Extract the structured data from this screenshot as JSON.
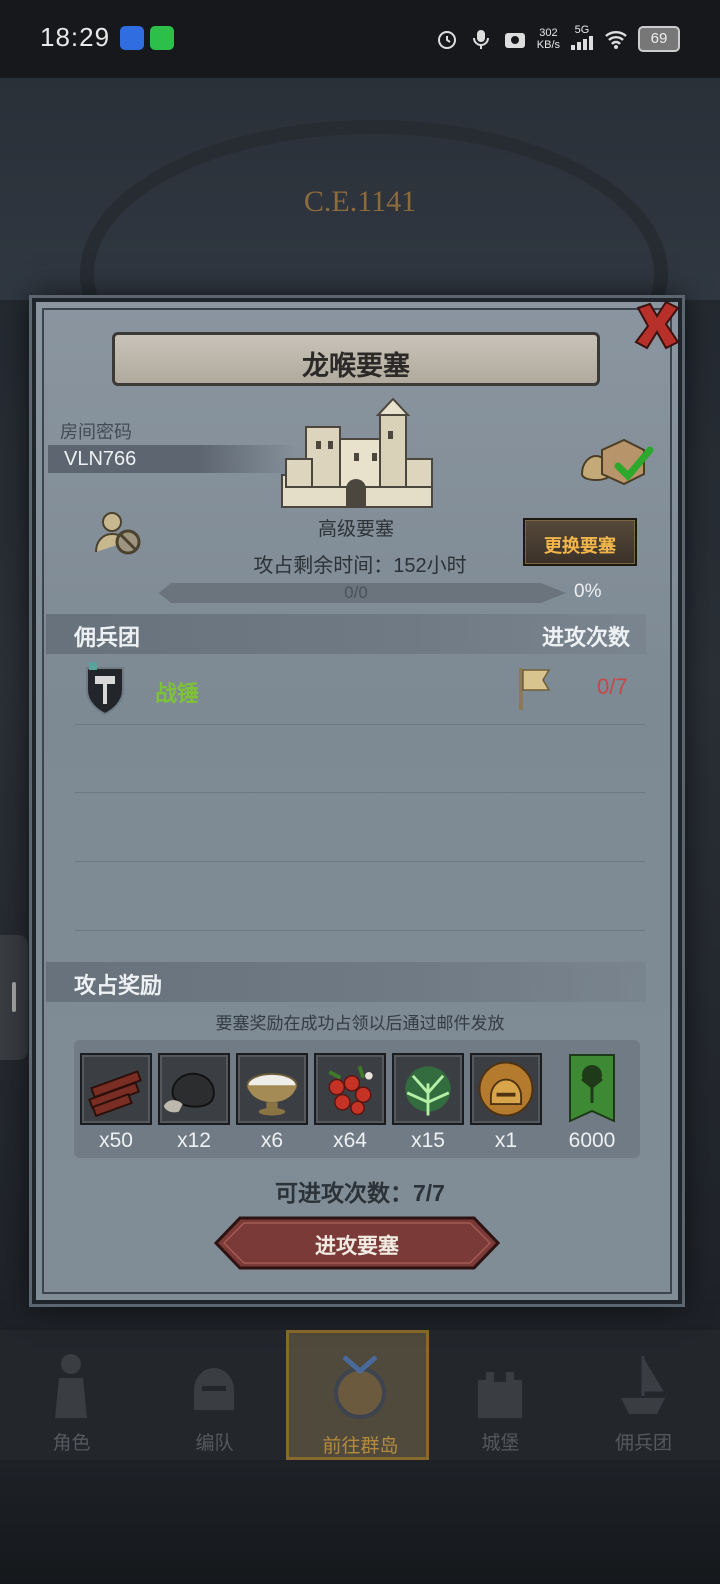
{
  "status_bar": {
    "time": "18:29",
    "net_speed": "302",
    "net_unit": "KB/s",
    "network": "5G",
    "battery": "69",
    "icons": [
      "app-icon-blue",
      "wechat-icon",
      "alarm-icon",
      "mic-icon",
      "camera-icon",
      "signal-icon",
      "wifi-icon"
    ]
  },
  "background": {
    "era": "C.E.1141"
  },
  "dialog": {
    "title": "龙喉要塞",
    "room_label": "房间密码",
    "room_code": "VLN766",
    "fortress_type": "高级要塞",
    "change_button": "更换要塞",
    "time_left": "攻占剩余时间：152小时",
    "progress": {
      "text": "0/0",
      "percent_label": "0%",
      "value": 0
    },
    "mercenary": {
      "header": "佣兵团",
      "attack_header": "进攻次数",
      "rows": [
        {
          "name": "战锤",
          "attacks": "0/7"
        }
      ]
    },
    "rewards": {
      "header": "攻占奖励",
      "note": "要塞奖励在成功占领以后通过邮件发放",
      "items": [
        {
          "icon": "wood-logs-icon",
          "qty": "x50"
        },
        {
          "icon": "stone-ore-icon",
          "qty": "x12"
        },
        {
          "icon": "white-bowl-icon",
          "qty": "x6"
        },
        {
          "icon": "red-berries-icon",
          "qty": "x64"
        },
        {
          "icon": "green-herb-icon",
          "qty": "x15"
        },
        {
          "icon": "golden-helmet-icon",
          "qty": "x1"
        },
        {
          "icon": "tree-banner-icon",
          "qty": "6000"
        }
      ]
    },
    "attacks_left": "可进攻次数：7/7",
    "attack_button": "进攻要塞"
  },
  "bottom_nav": [
    {
      "label": "角色",
      "icon": "knight-icon",
      "active": false
    },
    {
      "label": "编队",
      "icon": "helmet-icon",
      "active": false
    },
    {
      "label": "前往群岛",
      "icon": "compass-icon",
      "active": true
    },
    {
      "label": "城堡",
      "icon": "castle-icon",
      "active": false
    },
    {
      "label": "佣兵团",
      "icon": "ship-icon",
      "active": false
    }
  ],
  "colors": {
    "accent_gold": "#f2b64a",
    "guild_green": "#7ec23a",
    "count_red": "#c44a47",
    "button_red": "#7a3a38"
  }
}
